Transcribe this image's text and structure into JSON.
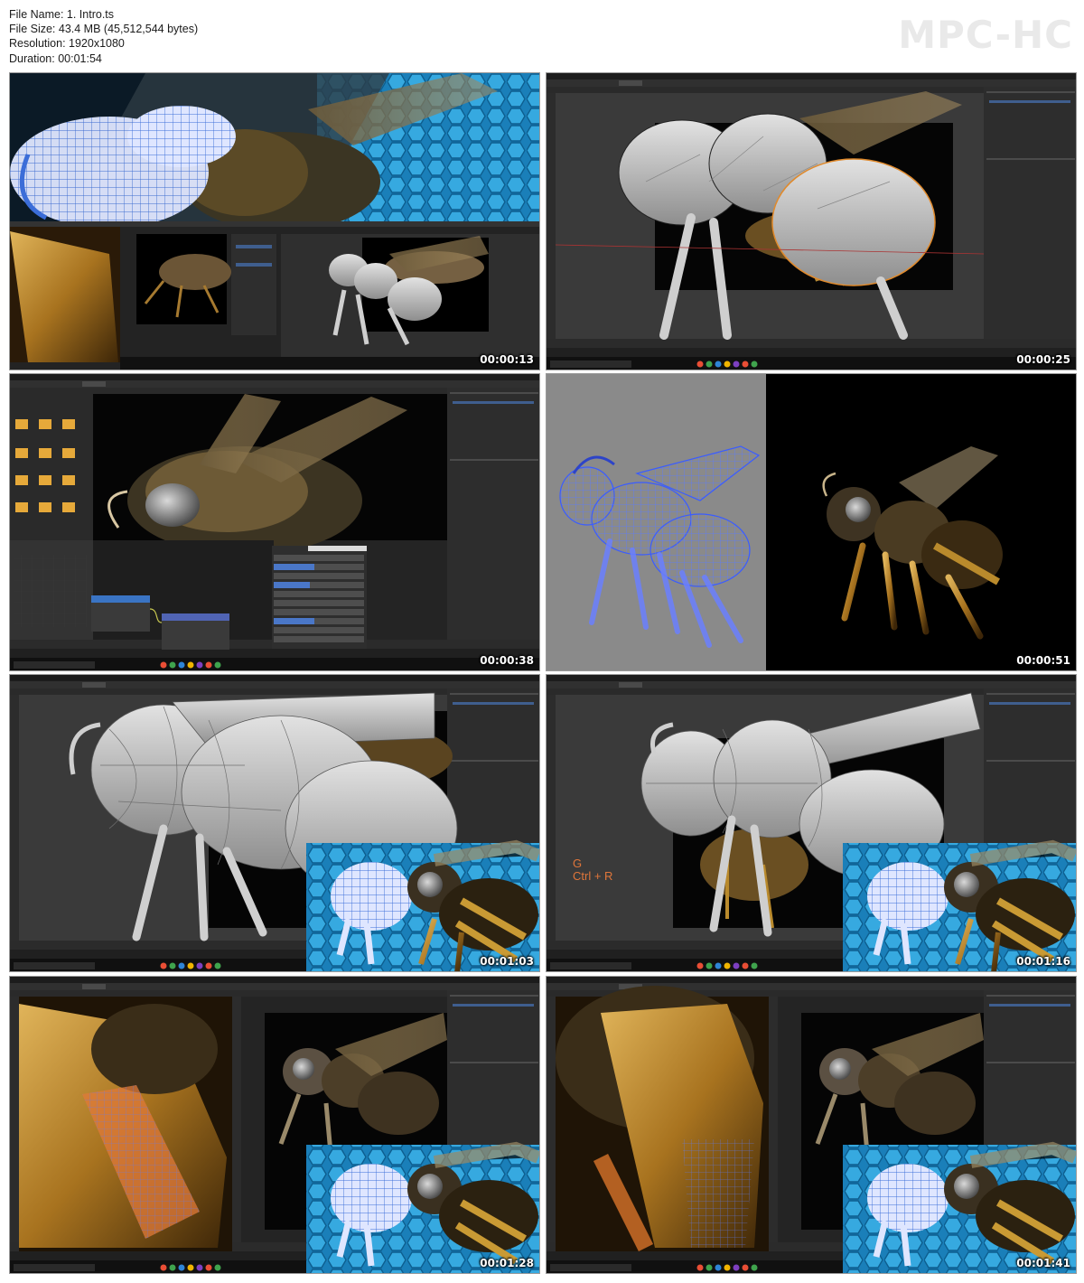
{
  "info": {
    "file_name": "File Name: 1. Intro.ts",
    "file_size": "File Size: 43.4 MB (45,512,544 bytes)",
    "resolution": "Resolution: 1920x1080",
    "duration": "Duration: 00:01:54"
  },
  "logo": "MPC-HC",
  "thumbnails": [
    {
      "timestamp": "00:00:13",
      "scene": "intro collage: wireframe bee render over hexagon backdrop, blender viewports"
    },
    {
      "timestamp": "00:00:25",
      "scene": "blender viewport: low-poly blockout of bee body over reference photo"
    },
    {
      "timestamp": "00:00:38",
      "scene": "blender shading workspace: bee close-up, file browser, node editor"
    },
    {
      "timestamp": "00:00:51",
      "scene": "blue wireframe bee model beside photo of a real bee"
    },
    {
      "timestamp": "00:01:03",
      "scene": "blender viewport: subdivided bee body with picture-in-picture render"
    },
    {
      "timestamp": "00:01:16",
      "scene": "blender viewport: bee body with G Ctrl + R keyboard hint",
      "hint_line1": "G",
      "hint_line2": "Ctrl + R"
    },
    {
      "timestamp": "00:01:28",
      "scene": "blender viewport: leg segment modeling over macro photo"
    },
    {
      "timestamp": "00:01:41",
      "scene": "blender viewport: leg wireframe over macro photo"
    }
  ],
  "colors": {
    "blender_bg": "#2b2b2b",
    "hex_blue": "#1d8fc9",
    "wire_blue": "#3a5cff",
    "bee_gold": "#b98a2c",
    "hint_orange": "#e0763a"
  }
}
